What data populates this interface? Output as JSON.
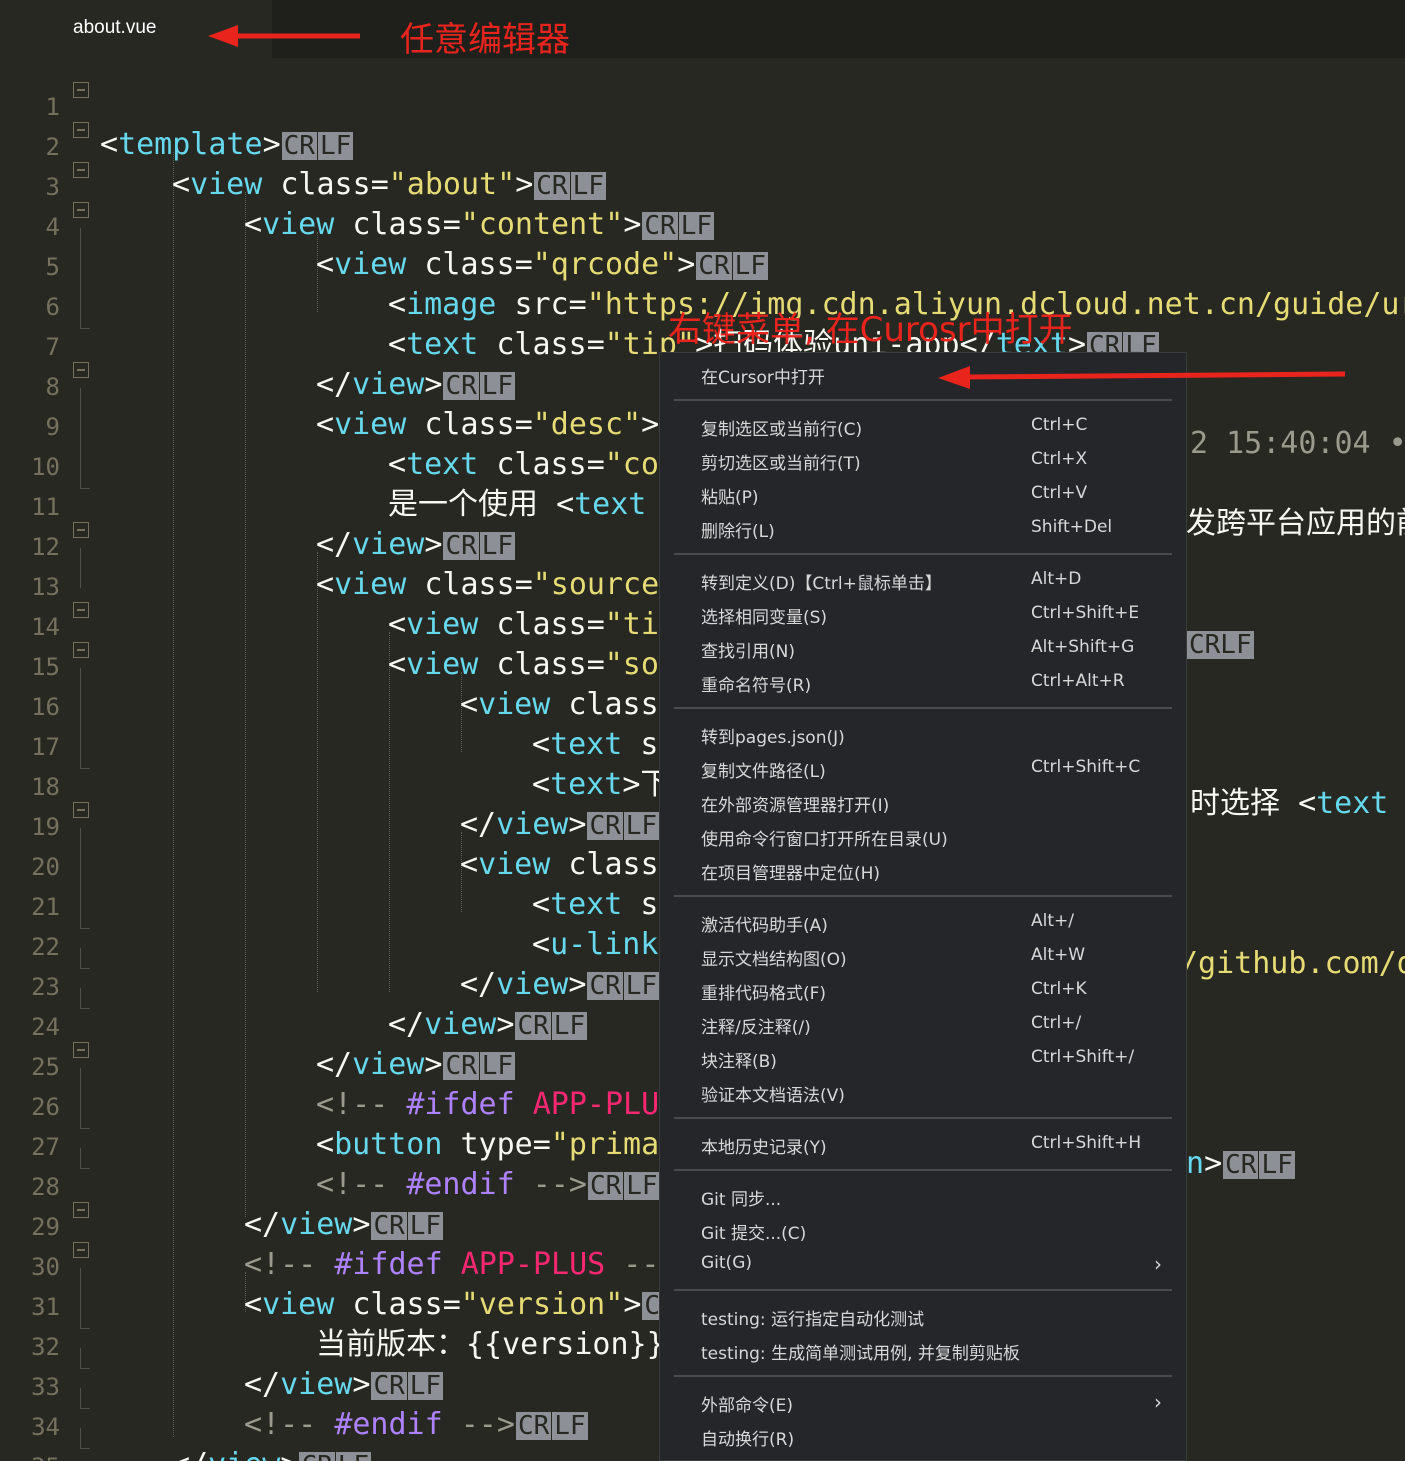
{
  "tab": {
    "title": "about.vue"
  },
  "annotations": {
    "editor_label": "任意编辑器",
    "menu_label": "右键菜单, 在Curosr中打开"
  },
  "colors": {
    "tag": "#66d9ef",
    "string": "#e6db74",
    "comment": "#9b9a8f",
    "directive": "#ae81ff",
    "macro": "#f92672",
    "annotation": "#e8241c"
  },
  "lines": [
    {
      "n": "1"
    },
    {
      "n": "2"
    },
    {
      "n": "3"
    },
    {
      "n": "4"
    },
    {
      "n": "5"
    },
    {
      "n": "6"
    },
    {
      "n": "7"
    },
    {
      "n": "8"
    },
    {
      "n": "9"
    },
    {
      "n": "10"
    },
    {
      "n": "11"
    },
    {
      "n": "12"
    },
    {
      "n": "13"
    },
    {
      "n": "14"
    },
    {
      "n": "15"
    },
    {
      "n": "16"
    },
    {
      "n": "17"
    },
    {
      "n": "18"
    },
    {
      "n": "19"
    },
    {
      "n": "20"
    },
    {
      "n": "21"
    },
    {
      "n": "22"
    },
    {
      "n": "23"
    },
    {
      "n": "24"
    },
    {
      "n": "25"
    },
    {
      "n": "26"
    },
    {
      "n": "27"
    },
    {
      "n": "28"
    },
    {
      "n": "29"
    },
    {
      "n": "30"
    },
    {
      "n": "31"
    },
    {
      "n": "32"
    },
    {
      "n": "33"
    },
    {
      "n": "34"
    },
    {
      "n": "35"
    }
  ],
  "code": {
    "eol": [
      "CR",
      "LF"
    ],
    "l1_tag": "template",
    "l2_tag": "view",
    "l2_attr": "class",
    "l2_val": "\"about\"",
    "l3_tag": "view",
    "l3_attr": "class",
    "l3_val": "\"content\"",
    "l4_tag": "view",
    "l4_attr": "class",
    "l4_val": "\"qrcode\"",
    "l5_tag": "image",
    "l5_attr": "src",
    "l5_val": "\"https://img.cdn.aliyun.dcloud.net.cn/guide/ur",
    "l6_tag": "text",
    "l6_attr": "class",
    "l6_val": "\"tip\"",
    "l6_text": "扫码体验uni-app",
    "l6_close": "text",
    "l7_tag": "view",
    "l8_tag": "view",
    "l8_attr": "class",
    "l8_val": "\"desc\"",
    "l8_right": "2 15:40:04 •",
    "l9_tag": "text",
    "l9_attr": "class",
    "l9_val": "\"co",
    "l10_text": "是一个使用 ",
    "l10_tag": "text",
    "l10_right": "发跨平台应用的前",
    "l11_tag": "view",
    "l12_tag": "view",
    "l12_attr": "class",
    "l12_val": "\"source",
    "l13_tag": "view",
    "l13_attr": "class",
    "l13_val": "\"ti",
    "l13_right": "CRLF",
    "l14_tag": "view",
    "l14_attr": "class",
    "l14_val": "\"so",
    "l15_tag": "view",
    "l15_attr": "class",
    "l16_tag": "text",
    "l16_attr": "s",
    "l17_tag": "text",
    "l17_text": "下",
    "l17_right_text": "时选择 ",
    "l17_right_tag": "text",
    "l18_tag": "view",
    "l19_tag": "view",
    "l19_attr": "class",
    "l20_tag": "text",
    "l20_attr": "s",
    "l21_tag": "u-link",
    "l21_right": "/github.com/d",
    "l22_tag": "view",
    "l23_tag": "view",
    "l24_tag": "view",
    "l25_c1": "<!-- ",
    "l25_d": "#ifdef",
    "l25_m": "APP-PLU",
    "l26_tag": "button",
    "l26_attr": "type",
    "l26_val": "\"prima",
    "l26_right": "n",
    "l27_c1": "<!-- ",
    "l27_d": "#endif",
    "l27_c2": " -->",
    "l28_tag": "view",
    "l29_c1": "<!-- ",
    "l29_d": "#ifdef",
    "l29_m": "APP-PLUS",
    "l29_c2": " --",
    "l30_tag": "view",
    "l30_attr": "class",
    "l30_val": "\"version\"",
    "l30_trail": "C",
    "l31_text": "当前版本：",
    "l31_expr": "{{version}}",
    "l32_tag": "view",
    "l33_c1": "<!-- ",
    "l33_d": "#endif",
    "l33_c2": " -->",
    "l34_tag": "view",
    "l35_tag": "template"
  },
  "menu": {
    "groups": [
      [
        {
          "label": "在Cursor中打开",
          "key": ""
        }
      ],
      [
        {
          "label": "复制选区或当前行(C)",
          "key": "Ctrl+C"
        },
        {
          "label": "剪切选区或当前行(T)",
          "key": "Ctrl+X"
        },
        {
          "label": "粘贴(P)",
          "key": "Ctrl+V"
        },
        {
          "label": "删除行(L)",
          "key": "Shift+Del"
        }
      ],
      [
        {
          "label": "转到定义(D)【Ctrl+鼠标单击】",
          "key": "Alt+D"
        },
        {
          "label": "选择相同变量(S)",
          "key": "Ctrl+Shift+E"
        },
        {
          "label": "查找引用(N)",
          "key": "Alt+Shift+G"
        },
        {
          "label": "重命名符号(R)",
          "key": "Ctrl+Alt+R"
        }
      ],
      [
        {
          "label": "转到pages.json(J)",
          "key": ""
        },
        {
          "label": "复制文件路径(L)",
          "key": "Ctrl+Shift+C"
        },
        {
          "label": "在外部资源管理器打开(I)",
          "key": ""
        },
        {
          "label": "使用命令行窗口打开所在目录(U)",
          "key": ""
        },
        {
          "label": "在项目管理器中定位(H)",
          "key": ""
        }
      ],
      [
        {
          "label": "激活代码助手(A)",
          "key": "Alt+/"
        },
        {
          "label": "显示文档结构图(O)",
          "key": "Alt+W"
        },
        {
          "label": "重排代码格式(F)",
          "key": "Ctrl+K"
        },
        {
          "label": "注释/反注释(/)",
          "key": "Ctrl+/"
        },
        {
          "label": "块注释(B)",
          "key": "Ctrl+Shift+/"
        },
        {
          "label": "验证本文档语法(V)",
          "key": ""
        }
      ],
      [
        {
          "label": "本地历史记录(Y)",
          "key": "Ctrl+Shift+H"
        }
      ],
      [
        {
          "label": "Git 同步...",
          "key": ""
        },
        {
          "label": "Git 提交...(C)",
          "key": ""
        },
        {
          "label": "Git(G)",
          "key": "",
          "submenu": "›"
        }
      ],
      [
        {
          "label": "testing: 运行指定自动化测试",
          "key": ""
        },
        {
          "label": "testing: 生成简单测试用例, 并复制剪贴板",
          "key": ""
        }
      ],
      [
        {
          "label": "外部命令(E)",
          "key": "",
          "submenu": "›"
        },
        {
          "label": "自动换行(R)",
          "key": ""
        }
      ]
    ]
  }
}
